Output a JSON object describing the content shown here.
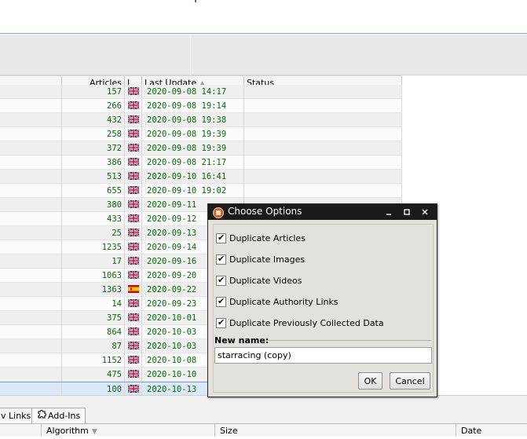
{
  "grid": {
    "columns": {
      "articles": "Articles",
      "lang": "L",
      "last_update": "Last Update",
      "status": "Status"
    },
    "rows": [
      {
        "articles": "157",
        "flag": "gb",
        "date": "2020-09-08 14:17"
      },
      {
        "articles": "266",
        "flag": "gb",
        "date": "2020-09-08 19:14"
      },
      {
        "articles": "432",
        "flag": "gb",
        "date": "2020-09-08 19:38"
      },
      {
        "articles": "258",
        "flag": "gb",
        "date": "2020-09-08 19:39"
      },
      {
        "articles": "372",
        "flag": "gb",
        "date": "2020-09-08 19:39"
      },
      {
        "articles": "386",
        "flag": "gb",
        "date": "2020-09-08 21:17"
      },
      {
        "articles": "513",
        "flag": "gb",
        "date": "2020-09-10 16:41"
      },
      {
        "articles": "655",
        "flag": "gb",
        "date": "2020-09-10 19:02"
      },
      {
        "articles": "380",
        "flag": "gb",
        "date": "2020-09-11"
      },
      {
        "articles": "433",
        "flag": "gb",
        "date": "2020-09-12"
      },
      {
        "articles": "25",
        "flag": "gb",
        "date": "2020-09-13"
      },
      {
        "articles": "1235",
        "flag": "gb",
        "date": "2020-09-14"
      },
      {
        "articles": "17",
        "flag": "gb",
        "date": "2020-09-16"
      },
      {
        "articles": "1063",
        "flag": "gb",
        "date": "2020-09-20"
      },
      {
        "articles": "1363",
        "flag": "es",
        "date": "2020-09-22"
      },
      {
        "articles": "14",
        "flag": "gb",
        "date": "2020-09-23"
      },
      {
        "articles": "375",
        "flag": "gb",
        "date": "2020-10-01"
      },
      {
        "articles": "864",
        "flag": "gb",
        "date": "2020-10-03"
      },
      {
        "articles": "87",
        "flag": "gb",
        "date": "2020-10-03"
      },
      {
        "articles": "1152",
        "flag": "gb",
        "date": "2020-10-08"
      },
      {
        "articles": "475",
        "flag": "gb",
        "date": "2020-10-10"
      },
      {
        "articles": "100",
        "flag": "gb",
        "date": "2020-10-13",
        "selected": true
      }
    ]
  },
  "tabs": {
    "links_partial": "v Links",
    "addins": "Add-Ins"
  },
  "bottom_grid": {
    "algorithm": "Algorithm",
    "size": "Size",
    "date": "Date"
  },
  "dialog": {
    "title": "Choose Options",
    "options": [
      {
        "label": "Duplicate Articles",
        "checked": true
      },
      {
        "label": "Duplicate Images",
        "checked": true
      },
      {
        "label": "Duplicate Videos",
        "checked": true
      },
      {
        "label": "Duplicate Authority Links",
        "checked": true
      },
      {
        "label": "Duplicate Previously Collected Data",
        "checked": true
      }
    ],
    "new_name_label": "New name:",
    "new_name_value": "starracing (copy)",
    "ok_label": "OK",
    "cancel_label": "Cancel"
  },
  "colors": {
    "numbers_green": "#0a6a0a",
    "dialog_title_bg": "#1b1b1b",
    "dialog_bg": "#e3e1dc",
    "selection_bg": "#dbe9f7"
  }
}
